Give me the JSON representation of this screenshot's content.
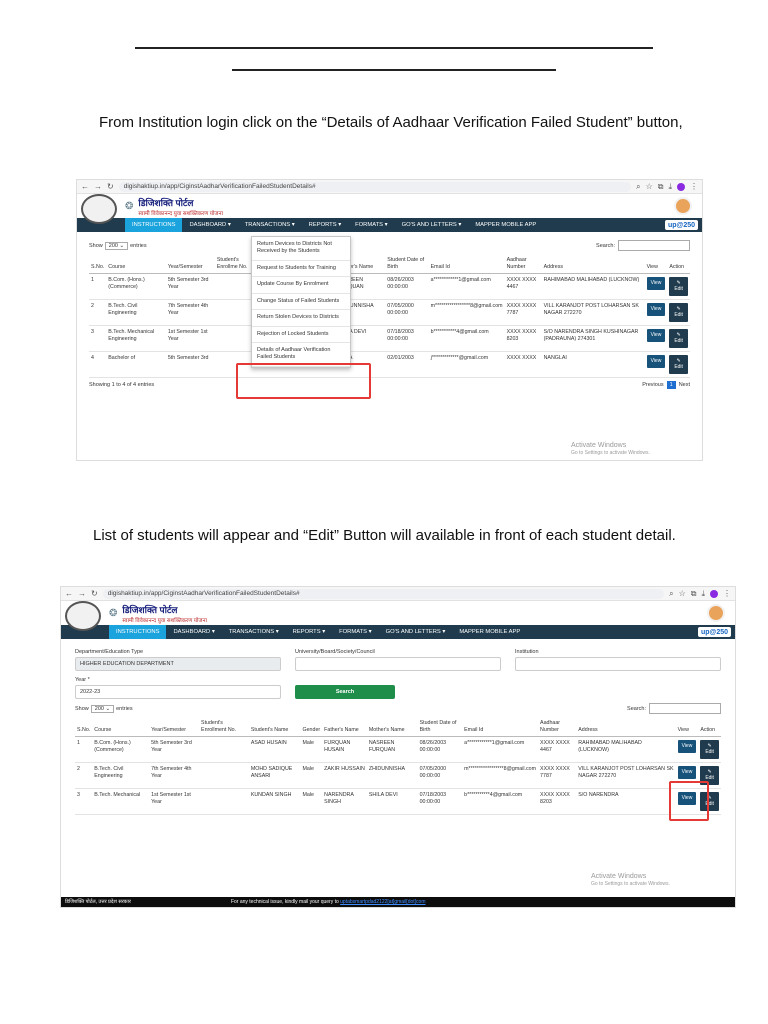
{
  "instructions": {
    "step1": "From Institution login click on the “Details of Aadhaar Verification Failed Student” button,",
    "step2": "List of students will appear and “Edit” Button will available in front of each student detail."
  },
  "browser": {
    "url": "digishaktiup.in/app/CiginstAadharVerificationFailedStudentDetails#"
  },
  "site": {
    "name": "डिजिशक्ति पोर्टल",
    "tagline": "स्वामी विवेकानन्द युवा सशक्तिकरण योजना",
    "logo_right": "up@250",
    "nav": [
      "INSTRUCTIONS",
      "DASHBOARD ▾",
      "TRANSACTIONS ▾",
      "REPORTS ▾",
      "FORMATS ▾",
      "GO'S AND LETTERS ▾",
      "MAPPER MOBILE APP"
    ]
  },
  "shot1": {
    "show_label": "Show",
    "show_value": "200 ⌄",
    "entries_label": "entries",
    "search_label": "Search:",
    "columns": [
      "S.No.",
      "Course",
      "Year/Semester",
      "Student's Enrollme No.",
      "",
      "",
      "ther's Name",
      "Mother's Name",
      "Student Date of Birth",
      "Email Id",
      "Aadhaar Number",
      "Address",
      "View",
      "Action"
    ],
    "rows": [
      [
        "1",
        "B.Com. (Hons.) (Commerce)",
        "5th Semester 3rd Year",
        "",
        "",
        "",
        "RQUAN SAIN",
        "NASREEN FURQUAN",
        "08/26/2003 00:00:00",
        "a************1@gmail.com",
        "XXXX XXXX 4467",
        "RAHIMABAD MALIHABAD (LUCKNOW)"
      ],
      [
        "2",
        "B.Tech. Civil Engineering",
        "7th Semester 4th Year",
        "",
        "",
        "",
        "KIR SSAIN",
        "ZHIDUNNISHA",
        "07/05/2000 00:00:00",
        "m*****************8@gmail.com",
        "XXXX XXXX 7787",
        "VILL KARANJOT POST LOHARSAN SK NAGAR 272270"
      ],
      [
        "3",
        "B.Tech. Mechanical Engineering",
        "1st Semester 1st Year",
        "",
        "",
        "",
        "RENDRA GH",
        "SHILA DEVI",
        "07/18/2003 00:00:00",
        "b***********4@gmail.com",
        "XXXX XXXX 8203",
        "S/O NARENDRA SINGH KUSHINAGAR (PADRAUNA) 274301"
      ],
      [
        "4",
        "Bachelor of",
        "5th Semester 3rd",
        "",
        "JAFHAR",
        "Male",
        "SIRAJUDDIN",
        "ASMA",
        "02/01/2003",
        "j*************@gmail.com",
        "XXXX XXXX",
        "NANGLAI"
      ]
    ],
    "view_label": "View",
    "edit_label": "Edit",
    "showing": "Showing 1 to 4 of 4 entries",
    "prev": "Previous",
    "page": "1",
    "next": "Next",
    "activate_title": "Activate Windows",
    "activate_sub": "Go to Settings to activate Windows.",
    "dropdown": [
      "Return Devices to Districts Not Received by the Students",
      "Request to Students for Training",
      "Update Course By Enrolment",
      "Change Status of Failed Students",
      "Return Stolen Devices to Districts",
      "Rejection of Locked Students",
      "Details of Aadhaar Verification Failed Students"
    ]
  },
  "shot2": {
    "form": {
      "dept_label": "Department/Education Type",
      "dept_value": "HIGHER EDUCATION DEPARTMENT",
      "univ_label": "University/Board/Society/Council",
      "inst_label": "Institution",
      "year_label": "Year *",
      "year_value": "2022-23",
      "search_button": "Search"
    },
    "show_label": "Show",
    "show_value": "200 ⌄",
    "entries_label": "entries",
    "search_label": "Search:",
    "columns": [
      "S.No.",
      "Course",
      "Year/Semester",
      "Student's Enrollment No.",
      "Student's Name",
      "Gender",
      "Father's Name",
      "Mother's Name",
      "Student Date of Birth",
      "Email Id",
      "Aadhaar Number",
      "Address",
      "View",
      "Action"
    ],
    "rows": [
      [
        "1",
        "B.Com. (Hons.) (Commerce)",
        "5th Semester 3rd Year",
        "",
        "ASAD HUSAIN",
        "Male",
        "FURQUAN HUSAIN",
        "NASREEN FURQUAN",
        "08/26/2003 00:00:00",
        "a************1@gmail.com",
        "XXXX XXXX 4467",
        "RAHIMABAD MALIHABAD (LUCKNOW)"
      ],
      [
        "2",
        "B.Tech. Civil Engineering",
        "7th Semester 4th Year",
        "",
        "MOHD SADIQUE ANSARI",
        "Male",
        "ZAKIR HUSSAIN",
        "ZHIDUNNISHA",
        "07/05/2000 00:00:00",
        "m*****************8@gmail.com",
        "XXXX XXXX 7787",
        "VILL KARANJOT POST LOHARSAN SK NAGAR 272270"
      ],
      [
        "3",
        "B.Tech. Mechanical",
        "1st Semester 1st Year",
        "",
        "KUNDAN SINGH",
        "Male",
        "NARENDRA SINGH",
        "SHILA DEVI",
        "07/18/2003 00:00:00",
        "b***********4@gmail.com",
        "XXXX XXXX 8203",
        "S/O NARENDRA"
      ]
    ],
    "view_label": "View",
    "edit_label": "Edit",
    "activate_title": "Activate Windows",
    "activate_sub": "Go to Settings to activate Windows.",
    "footer_left": "डिजिशक्ति पोर्टल, उत्तर प्रदेश सरकार",
    "footer_text": "For any technical issue, kindly mail your query to",
    "footer_email": "uptabsmartpdad2122[at]gmail[dot]com"
  }
}
